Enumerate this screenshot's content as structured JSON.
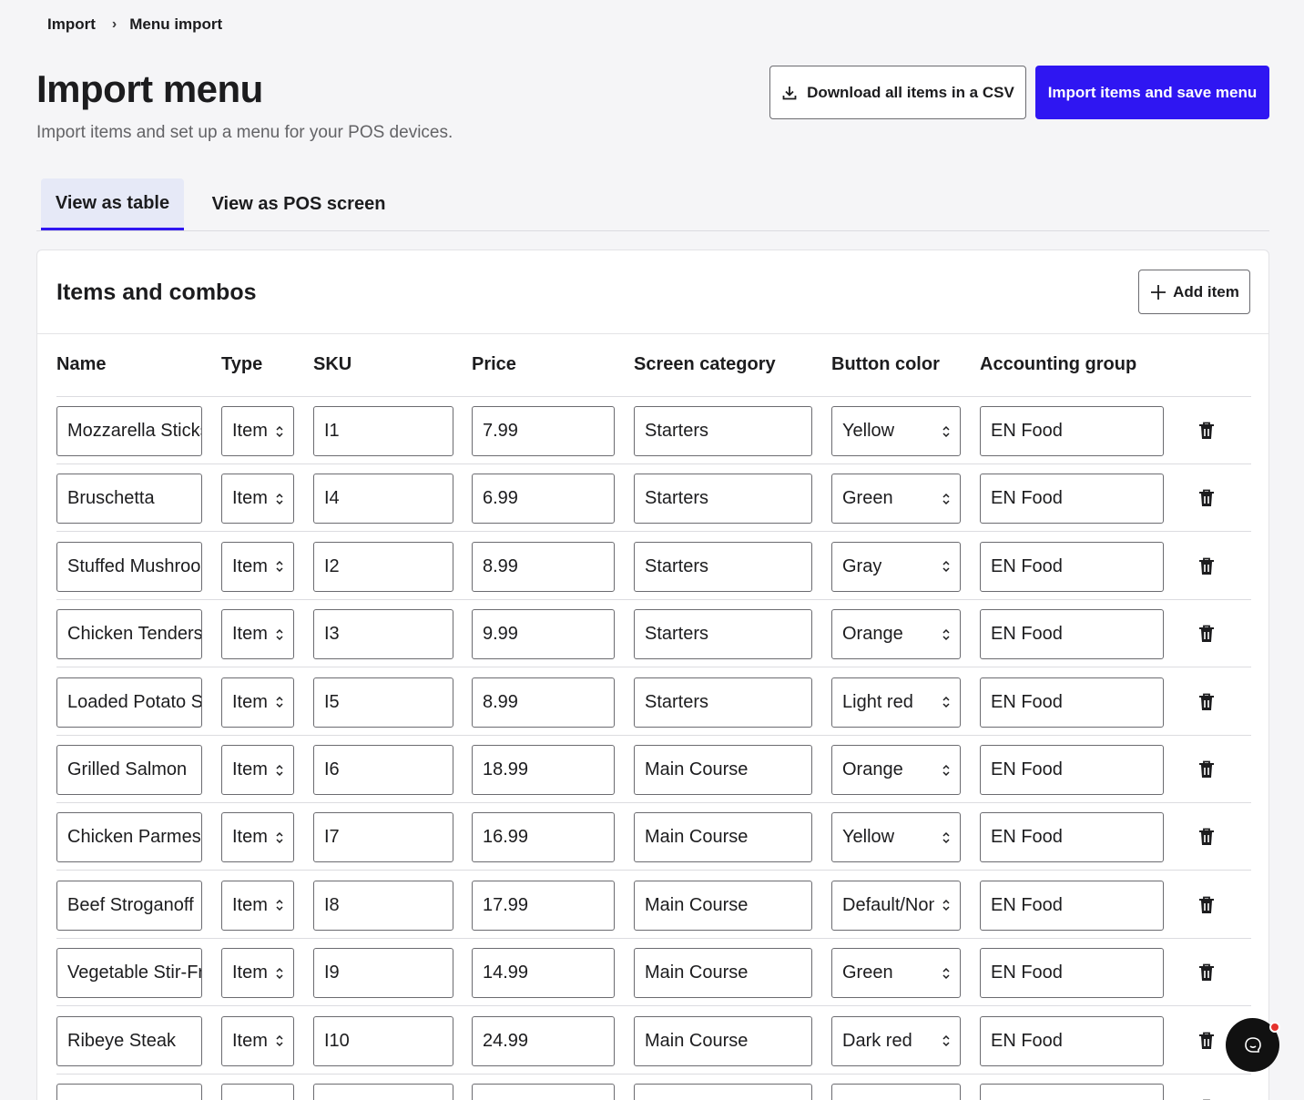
{
  "breadcrumb": {
    "parent": "Import",
    "current": "Menu import"
  },
  "header": {
    "title": "Import menu",
    "subtitle": "Import items and set up a menu for your POS devices.",
    "download_label": "Download all items in a CSV",
    "primary_label": "Import items and save menu"
  },
  "tabs": [
    {
      "label": "View as table",
      "active": true
    },
    {
      "label": "View as POS screen",
      "active": false
    }
  ],
  "card": {
    "title": "Items and combos",
    "add_label": "Add item"
  },
  "columns": [
    "Name",
    "Type",
    "SKU",
    "Price",
    "Screen category",
    "Button color",
    "Accounting group"
  ],
  "rows": [
    {
      "name": "Mozzarella Sticks",
      "type": "Item",
      "sku": "I1",
      "price": "7.99",
      "category": "Starters",
      "color": "Yellow",
      "group": "EN Food"
    },
    {
      "name": "Bruschetta",
      "type": "Item",
      "sku": "I4",
      "price": "6.99",
      "category": "Starters",
      "color": "Green",
      "group": "EN Food"
    },
    {
      "name": "Stuffed Mushrooms",
      "type": "Item",
      "sku": "I2",
      "price": "8.99",
      "category": "Starters",
      "color": "Gray",
      "group": "EN Food"
    },
    {
      "name": "Chicken Tenders",
      "type": "Item",
      "sku": "I3",
      "price": "9.99",
      "category": "Starters",
      "color": "Orange",
      "group": "EN Food"
    },
    {
      "name": "Loaded Potato Skins",
      "type": "Item",
      "sku": "I5",
      "price": "8.99",
      "category": "Starters",
      "color": "Light red",
      "group": "EN Food"
    },
    {
      "name": "Grilled Salmon",
      "type": "Item",
      "sku": "I6",
      "price": "18.99",
      "category": "Main Course",
      "color": "Orange",
      "group": "EN Food"
    },
    {
      "name": "Chicken Parmesan",
      "type": "Item",
      "sku": "I7",
      "price": "16.99",
      "category": "Main Course",
      "color": "Yellow",
      "group": "EN Food"
    },
    {
      "name": "Beef Stroganoff",
      "type": "Item",
      "sku": "I8",
      "price": "17.99",
      "category": "Main Course",
      "color": "Default/None",
      "group": "EN Food"
    },
    {
      "name": "Vegetable Stir-Fry",
      "type": "Item",
      "sku": "I9",
      "price": "14.99",
      "category": "Main Course",
      "color": "Green",
      "group": "EN Food"
    },
    {
      "name": "Ribeye Steak",
      "type": "Item",
      "sku": "I10",
      "price": "24.99",
      "category": "Main Course",
      "color": "Dark red",
      "group": "EN Food"
    },
    {
      "name": "",
      "type": "",
      "sku": "",
      "price": "",
      "category": "",
      "color": "",
      "group": ""
    }
  ],
  "icons": {
    "download": "download-icon",
    "add": "plus-icon",
    "delete": "trash-icon",
    "select": "chevron-updown-icon",
    "chat": "chat-icon"
  },
  "colors": {
    "accent": "#2f16f2",
    "tab_active_bg": "#e6e9f7",
    "notification": "#e5322d"
  }
}
